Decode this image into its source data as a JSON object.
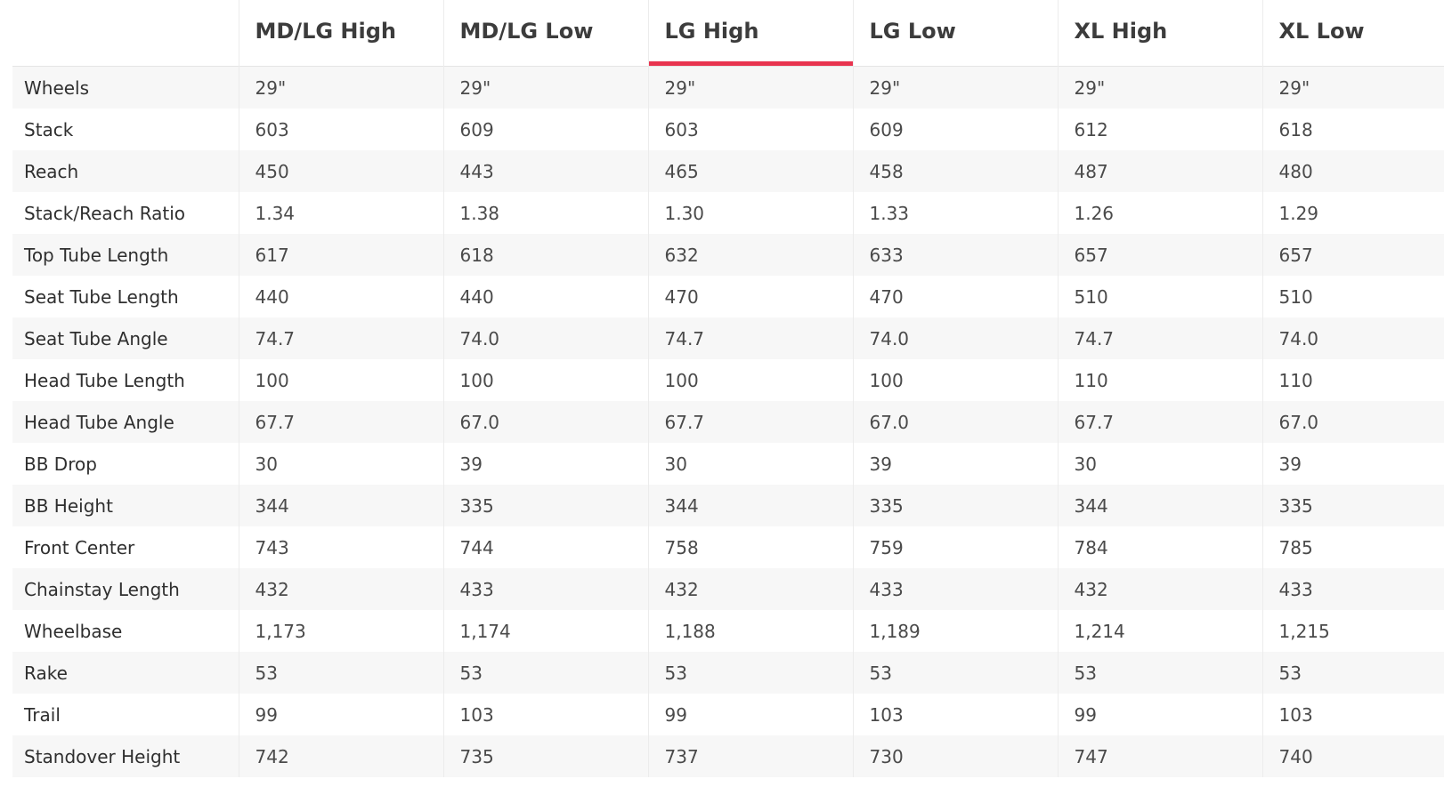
{
  "table": {
    "columns": [
      "MD/LG High",
      "MD/LG Low",
      "LG High",
      "LG Low",
      "XL High",
      "XL Low"
    ],
    "active_column": "LG High",
    "accent_color": "#e8344f",
    "rows": [
      {
        "label": "Wheels",
        "values": [
          "29\"",
          "29\"",
          "29\"",
          "29\"",
          "29\"",
          "29\""
        ]
      },
      {
        "label": "Stack",
        "values": [
          "603",
          "609",
          "603",
          "609",
          "612",
          "618"
        ]
      },
      {
        "label": "Reach",
        "values": [
          "450",
          "443",
          "465",
          "458",
          "487",
          "480"
        ]
      },
      {
        "label": "Stack/Reach Ratio",
        "values": [
          "1.34",
          "1.38",
          "1.30",
          "1.33",
          "1.26",
          "1.29"
        ]
      },
      {
        "label": "Top Tube Length",
        "values": [
          "617",
          "618",
          "632",
          "633",
          "657",
          "657"
        ]
      },
      {
        "label": "Seat Tube Length",
        "values": [
          "440",
          "440",
          "470",
          "470",
          "510",
          "510"
        ]
      },
      {
        "label": "Seat Tube Angle",
        "values": [
          "74.7",
          "74.0",
          "74.7",
          "74.0",
          "74.7",
          "74.0"
        ]
      },
      {
        "label": "Head Tube Length",
        "values": [
          "100",
          "100",
          "100",
          "100",
          "110",
          "110"
        ]
      },
      {
        "label": "Head Tube Angle",
        "values": [
          "67.7",
          "67.0",
          "67.7",
          "67.0",
          "67.7",
          "67.0"
        ]
      },
      {
        "label": "BB Drop",
        "values": [
          "30",
          "39",
          "30",
          "39",
          "30",
          "39"
        ]
      },
      {
        "label": "BB Height",
        "values": [
          "344",
          "335",
          "344",
          "335",
          "344",
          "335"
        ]
      },
      {
        "label": "Front Center",
        "values": [
          "743",
          "744",
          "758",
          "759",
          "784",
          "785"
        ]
      },
      {
        "label": "Chainstay Length",
        "values": [
          "432",
          "433",
          "432",
          "433",
          "432",
          "433"
        ]
      },
      {
        "label": "Wheelbase",
        "values": [
          "1,173",
          "1,174",
          "1,188",
          "1,189",
          "1,214",
          "1,215"
        ]
      },
      {
        "label": "Rake",
        "values": [
          "53",
          "53",
          "53",
          "53",
          "53",
          "53"
        ]
      },
      {
        "label": "Trail",
        "values": [
          "99",
          "103",
          "99",
          "103",
          "99",
          "103"
        ]
      },
      {
        "label": "Standover Height",
        "values": [
          "742",
          "735",
          "737",
          "730",
          "747",
          "740"
        ]
      }
    ]
  }
}
